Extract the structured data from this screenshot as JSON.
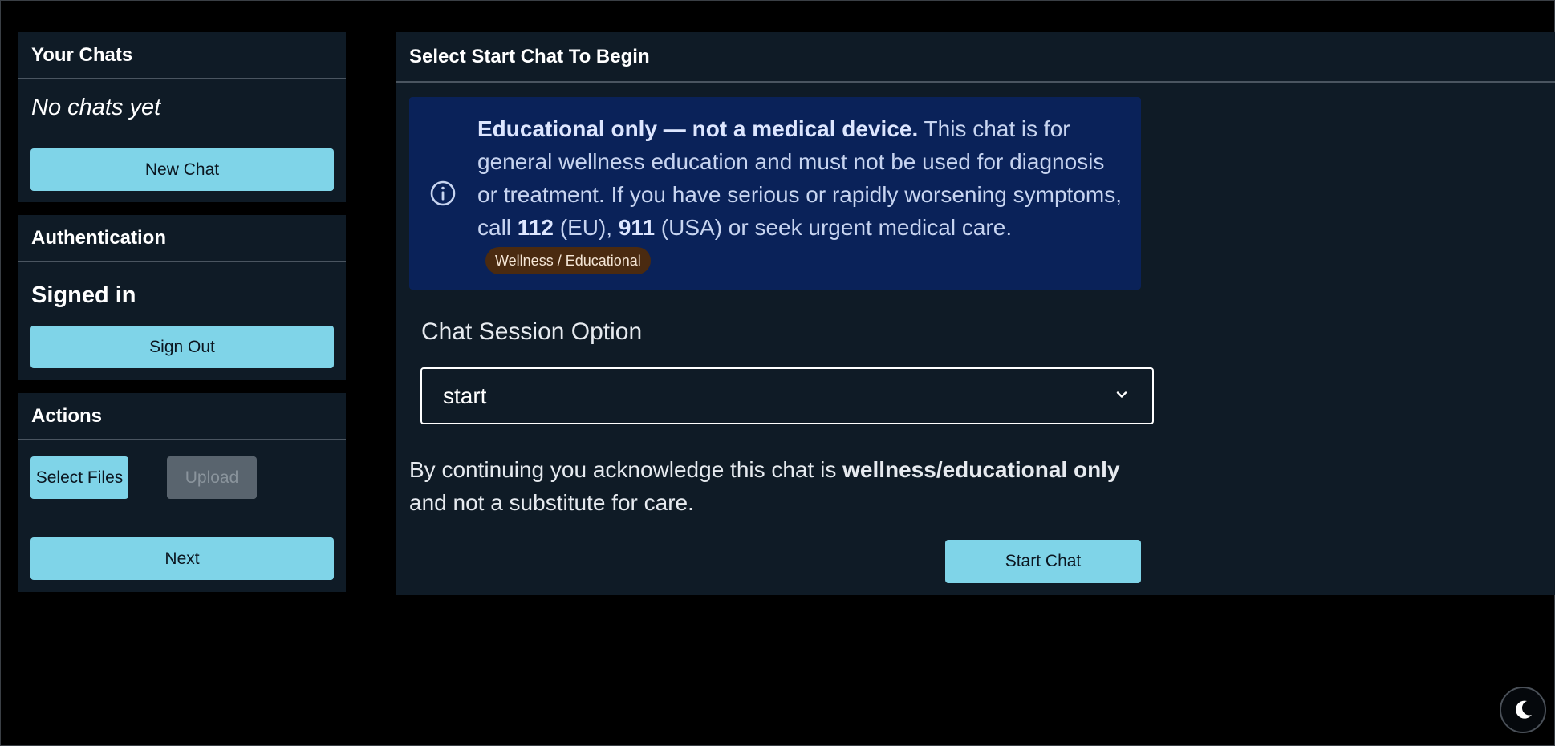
{
  "sidebar": {
    "chats": {
      "title": "Your Chats",
      "empty_text": "No chats yet",
      "new_chat_label": "New Chat"
    },
    "auth": {
      "title": "Authentication",
      "status": "Signed in",
      "sign_out_label": "Sign Out"
    },
    "actions": {
      "title": "Actions",
      "select_files_label": "Select Files",
      "upload_label": "Upload",
      "next_label": "Next"
    }
  },
  "main": {
    "title": "Select Start Chat To Begin",
    "notice": {
      "bold_lead": "Educational only — not a medical device.",
      "text_1": " This chat is for general wellness education and must not be used for diagnosis or treatment. If you have serious or rapidly worsening symptoms, call ",
      "num_eu": "112",
      "text_2": " (EU), ",
      "num_us": "911",
      "text_3": " (USA) or seek urgent medical care.",
      "badge": "Wellness / Educational",
      "icon": "info-icon"
    },
    "session": {
      "label": "Chat Session Option",
      "selected": "start"
    },
    "ack": {
      "text_1": "By continuing you acknowledge this chat is ",
      "bold_1": "wellness/educational only",
      "text_2": " and not a substitute for care."
    },
    "start_chat_label": "Start Chat"
  },
  "theme_toggle": {
    "icon": "moon-icon"
  },
  "colors": {
    "accent": "#7fd4e8",
    "panel": "#0f1b26",
    "notice_bg": "#0a2259",
    "badge_bg": "#4a2a10"
  }
}
